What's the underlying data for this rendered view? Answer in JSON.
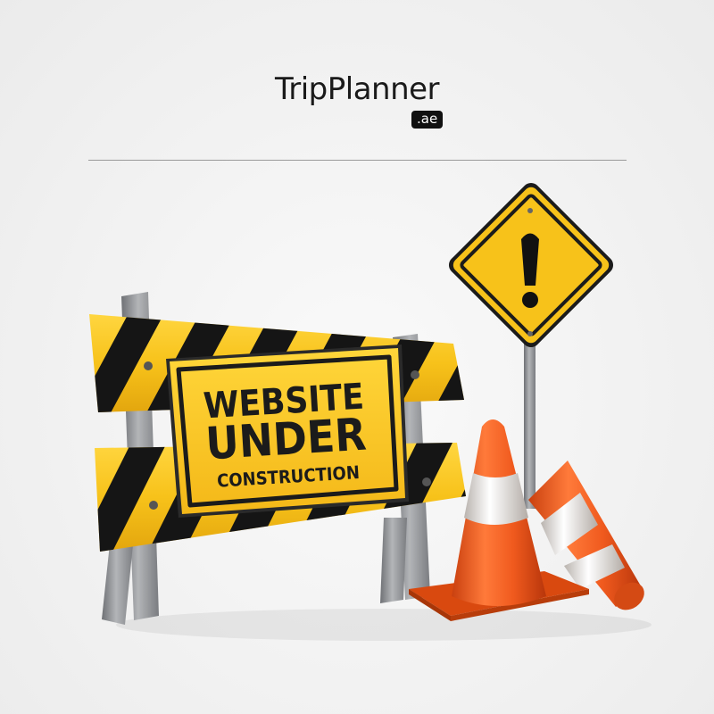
{
  "brand": {
    "name": "TripPlanner",
    "tld": ".ae"
  },
  "notice": {
    "line1": "WEBSITE",
    "line2": "UNDER",
    "line3": "CONSTRUCTION"
  },
  "warning_sign": {
    "symbol": "!"
  },
  "colors": {
    "background": "#f2f2f2",
    "barrier_yellow": "#f7c21a",
    "stripe_black": "#151515",
    "cone_orange": "#f05a1e",
    "cone_stripe": "#e9e4e0",
    "post_grey": "#8d8f93"
  },
  "icons": [
    "barrier-icon",
    "warning-sign-icon",
    "traffic-cone-icon"
  ]
}
